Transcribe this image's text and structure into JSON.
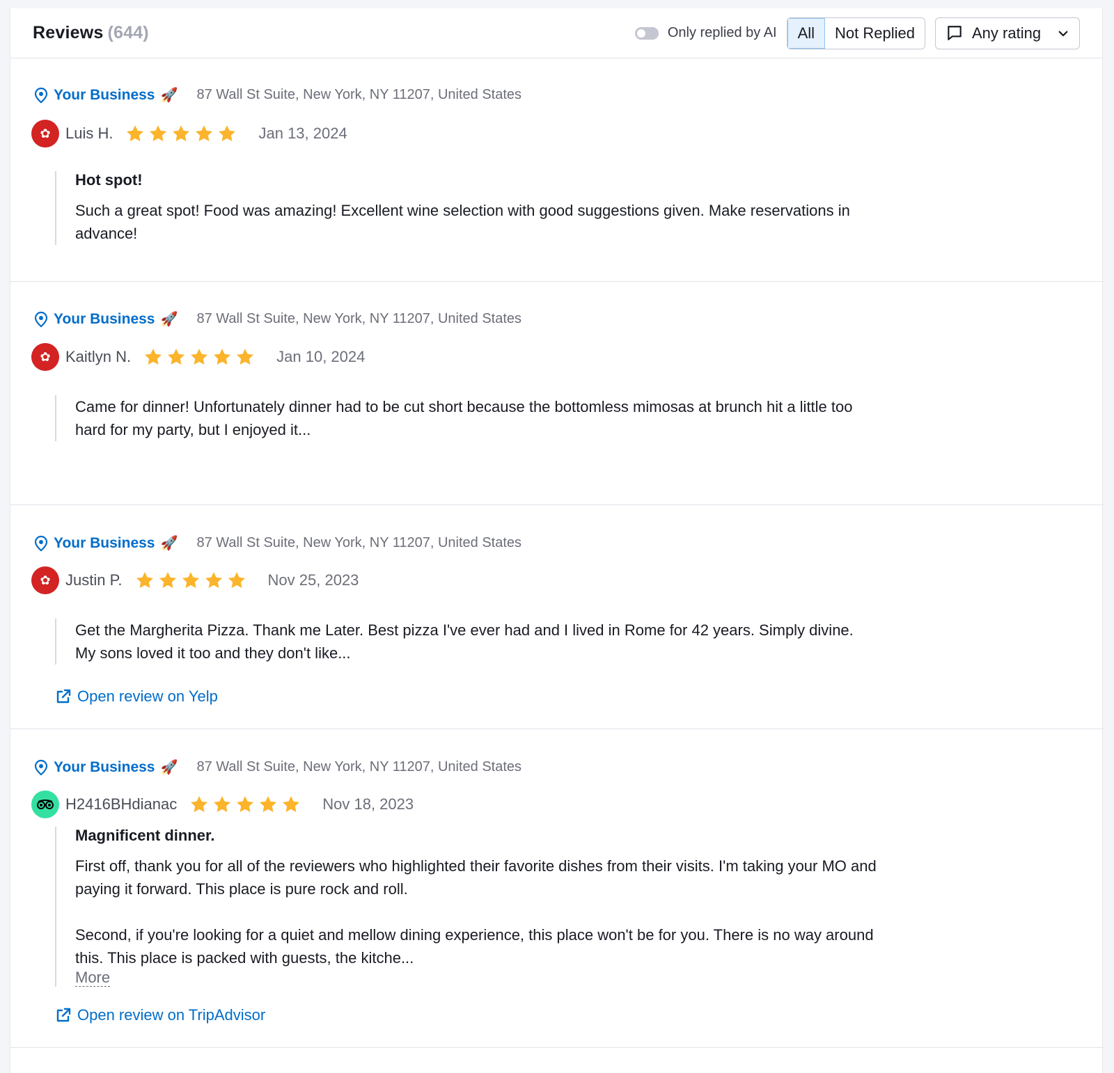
{
  "header": {
    "title": "Reviews",
    "count": "(644)",
    "toggle_label": "Only replied by AI",
    "segments": [
      "All",
      "Not Replied"
    ],
    "active_segment": "All",
    "rating_filter": "Any rating"
  },
  "colors": {
    "accent_blue": "#006dca",
    "star_gold": "#fbb42b",
    "yelp_red": "#d32323",
    "tripadvisor_green": "#34e0a1"
  },
  "reviews": [
    {
      "business": "Your Business",
      "business_icon": "rocket-icon",
      "address": "87 Wall St Suite, New York, NY 11207, United States",
      "source": "yelp",
      "author": "Luis H.",
      "rating": 5,
      "date": "Jan 13, 2024",
      "title": "Hot spot!",
      "text": [
        "Such a great spot! Food was amazing! Excellent wine selection with good suggestions given. Make reservations in advance!"
      ]
    },
    {
      "business": "Your Business",
      "business_icon": "rocket-icon",
      "address": "87 Wall St Suite, New York, NY 11207, United States",
      "source": "yelp",
      "author": "Kaitlyn N.",
      "rating": 5,
      "date": "Jan 10, 2024",
      "title": "",
      "text": [
        "Came for dinner! Unfortunately dinner had to be cut short because the bottomless mimosas at brunch hit a little too hard for my party, but I enjoyed it..."
      ]
    },
    {
      "business": "Your Business",
      "business_icon": "rocket-icon",
      "address": "87 Wall St Suite, New York, NY 11207, United States",
      "source": "yelp",
      "author": "Justin P.",
      "rating": 5,
      "date": "Nov 25, 2023",
      "title": "",
      "text": [
        "Get the Margherita Pizza. Thank me Later. Best pizza I've ever had and I lived in Rome for 42 years. Simply divine. My sons loved it too and they don't like..."
      ],
      "link": "Open review on Yelp"
    },
    {
      "business": "Your Business",
      "business_icon": "rocket-icon",
      "address": "87 Wall St Suite, New York, NY 11207, United States",
      "source": "tripadvisor",
      "author": "H2416BHdianac",
      "rating": 5,
      "date": "Nov 18, 2023",
      "title": "Magnificent dinner.",
      "text": [
        "First off, thank you for all of the reviewers who highlighted their favorite dishes from their visits. I'm taking your MO and paying it forward. This place is pure rock and roll.",
        "Second, if you're looking for a quiet and mellow dining experience, this place won't be for you. There is no way around this. This place is packed with guests, the kitche..."
      ],
      "more": "More",
      "link": "Open review on TripAdvisor"
    }
  ]
}
